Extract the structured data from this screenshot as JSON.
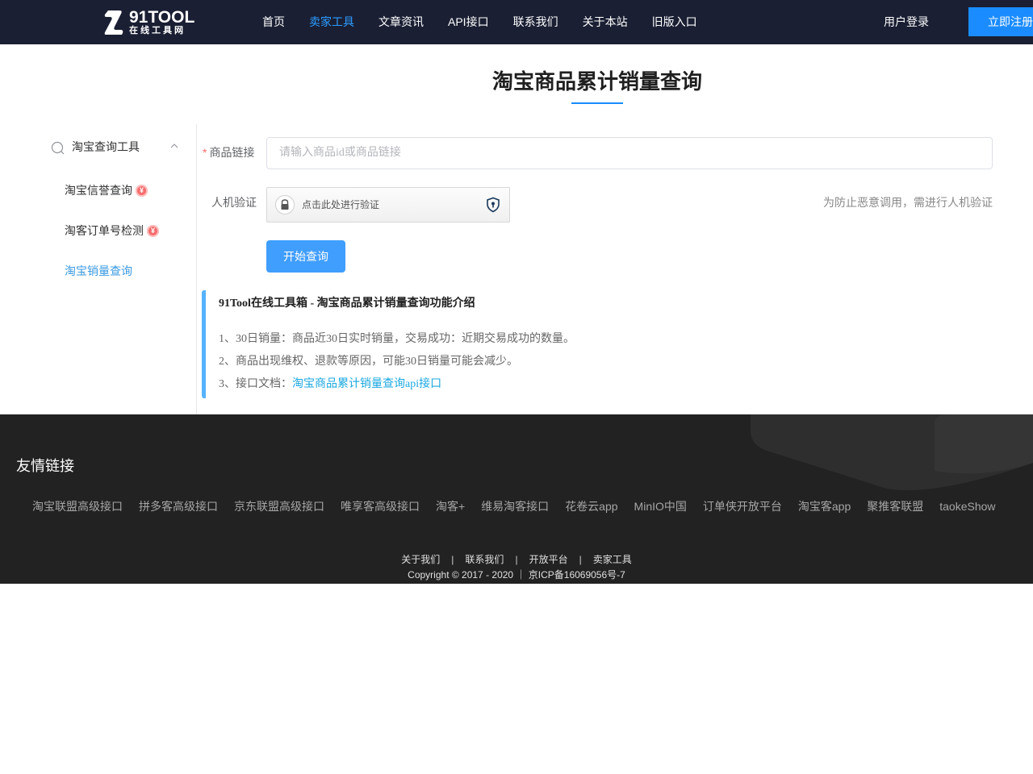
{
  "header": {
    "logo_text": "91TOOL",
    "logo_sub": "在线工具网",
    "nav": [
      "首页",
      "卖家工具",
      "文章资讯",
      "API接口",
      "联系我们",
      "关于本站",
      "旧版入口"
    ],
    "active_nav": "卖家工具",
    "login": "用户登录",
    "register": "立即注册"
  },
  "page_title": "淘宝商品累计销量查询",
  "sidebar": {
    "group_label": "淘宝查询工具",
    "items": [
      {
        "label": "淘宝信誉查询",
        "badge": "¥"
      },
      {
        "label": "淘客订单号检测",
        "badge": "¥"
      },
      {
        "label": "淘宝销量查询"
      }
    ]
  },
  "form": {
    "required_mark": "*",
    "url_label": "商品链接",
    "url_placeholder": "请输入商品id或商品链接",
    "url_value": "",
    "captcha_label": "人机验证",
    "captcha_text": "点击此处进行验证",
    "captcha_hint": "为防止恶意调用，需进行人机验证",
    "submit": "开始查询"
  },
  "info": {
    "title": "91Tool在线工具箱 - 淘宝商品累计销量查询功能介绍",
    "line1": "1、30日销量：商品近30日实时销量，交易成功：近期交易成功的数量。",
    "line2": "2、商品出现维权、退款等原因，可能30日销量可能会减少。",
    "line3_prefix": "3、接口文档：",
    "line3_link": "淘宝商品累计销量查询api接口"
  },
  "footer": {
    "friends_title": "友情链接",
    "links": [
      "淘宝联盟高级接口",
      "拼多客高级接口",
      "京东联盟高级接口",
      "唯享客高级接口",
      "淘客+",
      "维易淘客接口",
      "花卷云app",
      "MinIO中国",
      "订单侠开放平台",
      "淘宝客app",
      "聚推客联盟",
      "taokeShow"
    ],
    "nav": [
      "关于我们",
      "联系我们",
      "开放平台",
      "卖家工具"
    ],
    "separator": "|",
    "copyright": "Copyright © 2017 - 2020 ｜ 京ICP备16069056号-7"
  },
  "colors": {
    "header_bg": "#1a1f33",
    "accent": "#1a8cff",
    "button": "#409eff",
    "footer_bg": "#222222",
    "sidebar_active": "#3a9ae0"
  }
}
